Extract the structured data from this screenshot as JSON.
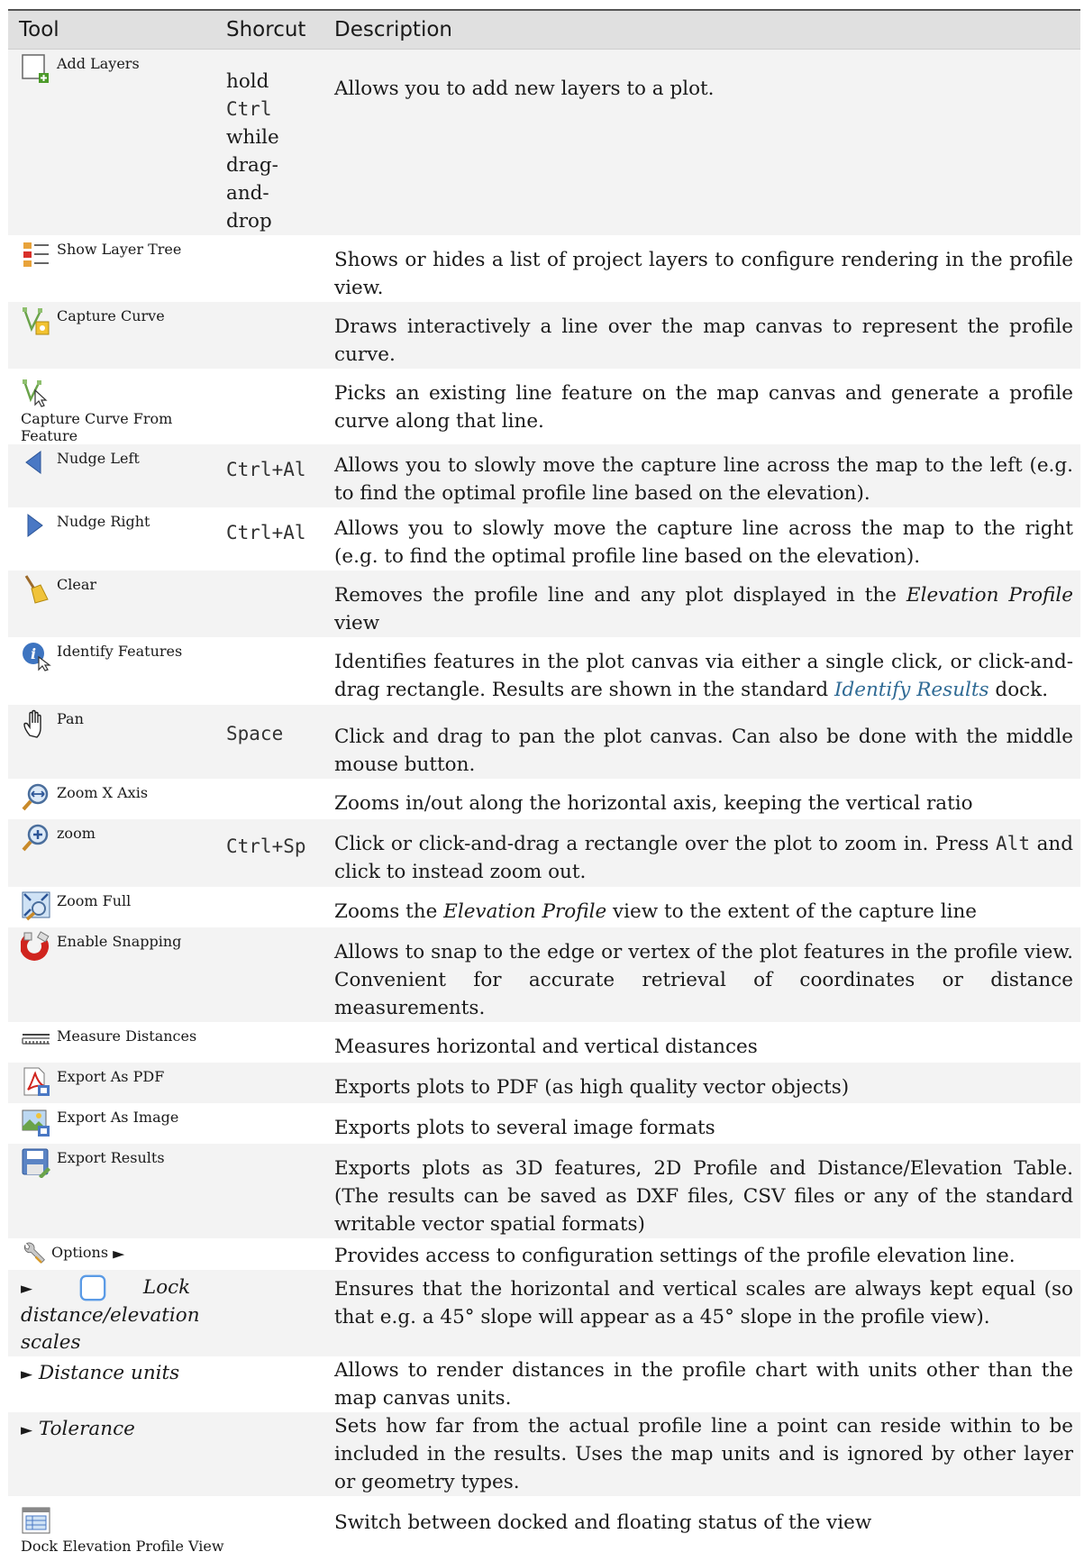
{
  "header": {
    "tool": "Tool",
    "shortcut": "Shorcut",
    "description": "Description"
  },
  "rows": [
    {
      "tool": "Add Layers",
      "icon": "add-layers-icon",
      "shortcut_parts": [
        "hold",
        "Ctrl",
        "while",
        "drag-",
        "and-",
        "drop"
      ],
      "desc": "Allows you to add new layers to a plot."
    },
    {
      "tool": "Show Layer Tree",
      "icon": "layer-tree-icon",
      "shortcut": "",
      "desc": "Shows or hides a list of project layers to configure rendering in the profile view."
    },
    {
      "tool": "Capture Curve",
      "icon": "capture-curve-icon",
      "shortcut": "",
      "desc": "Draws interactively a line over the map canvas to represent the profile curve."
    },
    {
      "tool": "Capture Curve From Feature",
      "icon": "capture-from-feature-icon",
      "shortcut": "",
      "desc": "Picks an existing line feature on the map canvas and generate a profile curve along that line."
    },
    {
      "tool": "Nudge Left",
      "icon": "nudge-left-icon",
      "shortcut": "Ctrl+Al",
      "desc": "Allows you to slowly move the capture line across the map to the left (e.g. to find the optimal profile line based on the elevation)."
    },
    {
      "tool": "Nudge Right",
      "icon": "nudge-right-icon",
      "shortcut": "Ctrl+Al",
      "desc": "Allows you to slowly move the capture line across the map to the right (e.g. to find the optimal profile line based on the elevation)."
    },
    {
      "tool": "Clear",
      "icon": "broom-icon",
      "shortcut": "",
      "desc_a": "Removes the profile line and any plot displayed in the ",
      "desc_em": "Elevation Profile",
      "desc_b": " view"
    },
    {
      "tool": "Identify Features",
      "icon": "identify-icon",
      "shortcut": "",
      "desc_a": "Identifies features in the plot canvas via either a single click, or click-and-drag rectangle. Results are shown in the standard ",
      "desc_link": "Identify Results",
      "desc_b": " dock."
    },
    {
      "tool": "Pan",
      "icon": "pan-hand-icon",
      "shortcut": "Space",
      "desc": "Click and drag to pan the plot canvas. Can also be done with the middle mouse button."
    },
    {
      "tool": "Zoom X Axis",
      "icon": "zoom-x-axis-icon",
      "shortcut": "",
      "desc": "Zooms in/out along the horizontal axis, keeping the vertical ratio"
    },
    {
      "tool": "zoom",
      "icon": "zoom-in-icon",
      "shortcut": "Ctrl+Sp",
      "desc_a": "Click or click-and-drag a rectangle over the plot to zoom in. Press ",
      "desc_mono": "Alt",
      "desc_b": " and click to instead zoom out."
    },
    {
      "tool": "Zoom Full",
      "icon": "zoom-full-icon",
      "shortcut": "",
      "desc_a": "Zooms the ",
      "desc_em": "Elevation Profile",
      "desc_b": " view to the extent of the capture line"
    },
    {
      "tool": "Enable Snapping",
      "icon": "magnet-icon",
      "shortcut": "",
      "desc": "Allows to snap to the edge or vertex of the plot features in the profile view. Convenient for accurate retrieval of coordinates or distance measurements."
    },
    {
      "tool": "Measure Distances",
      "icon": "ruler-icon",
      "shortcut": "",
      "desc": "Measures horizontal and vertical distances"
    },
    {
      "tool": "Export As PDF",
      "icon": "pdf-icon",
      "shortcut": "",
      "desc": "Exports plots to PDF (as high quality vector objects)"
    },
    {
      "tool": "Export As Image",
      "icon": "image-export-icon",
      "shortcut": "",
      "desc": "Exports plots to several image formats"
    },
    {
      "tool": "Export Results",
      "icon": "save-icon",
      "shortcut": "",
      "desc": "Exports plots as 3D features, 2D Profile and Distance/Elevation Table. (The results can be saved as DXF files, CSV files or any of the standard writable vector spatial formats)"
    },
    {
      "tool": "Options",
      "icon": "wrench-icon",
      "shortcut": "",
      "desc": "Provides access to configuration settings of the profile elevation line."
    },
    {
      "tool": "Lock distance/elevation scales",
      "icon": "checkbox-icon",
      "shortcut": "",
      "desc": "Ensures that the horizontal and vertical scales are always kept equal (so that e.g. a 45° slope will appear as a 45° slope in the profile view)."
    },
    {
      "tool": "Distance units",
      "shortcut": "",
      "desc": "Allows to render distances in the profile chart with units other than the map canvas units."
    },
    {
      "tool": "Tolerance",
      "shortcut": "",
      "desc": "Sets how far from the actual profile line a point can reside within to be included in the results. Uses the map units and is ignored by other layer or geometry types."
    },
    {
      "tool": "Dock Elevation Profile View",
      "icon": "dock-window-icon",
      "shortcut": "",
      "desc": "Switch between docked and floating status of the view"
    }
  ],
  "arrow": "►"
}
